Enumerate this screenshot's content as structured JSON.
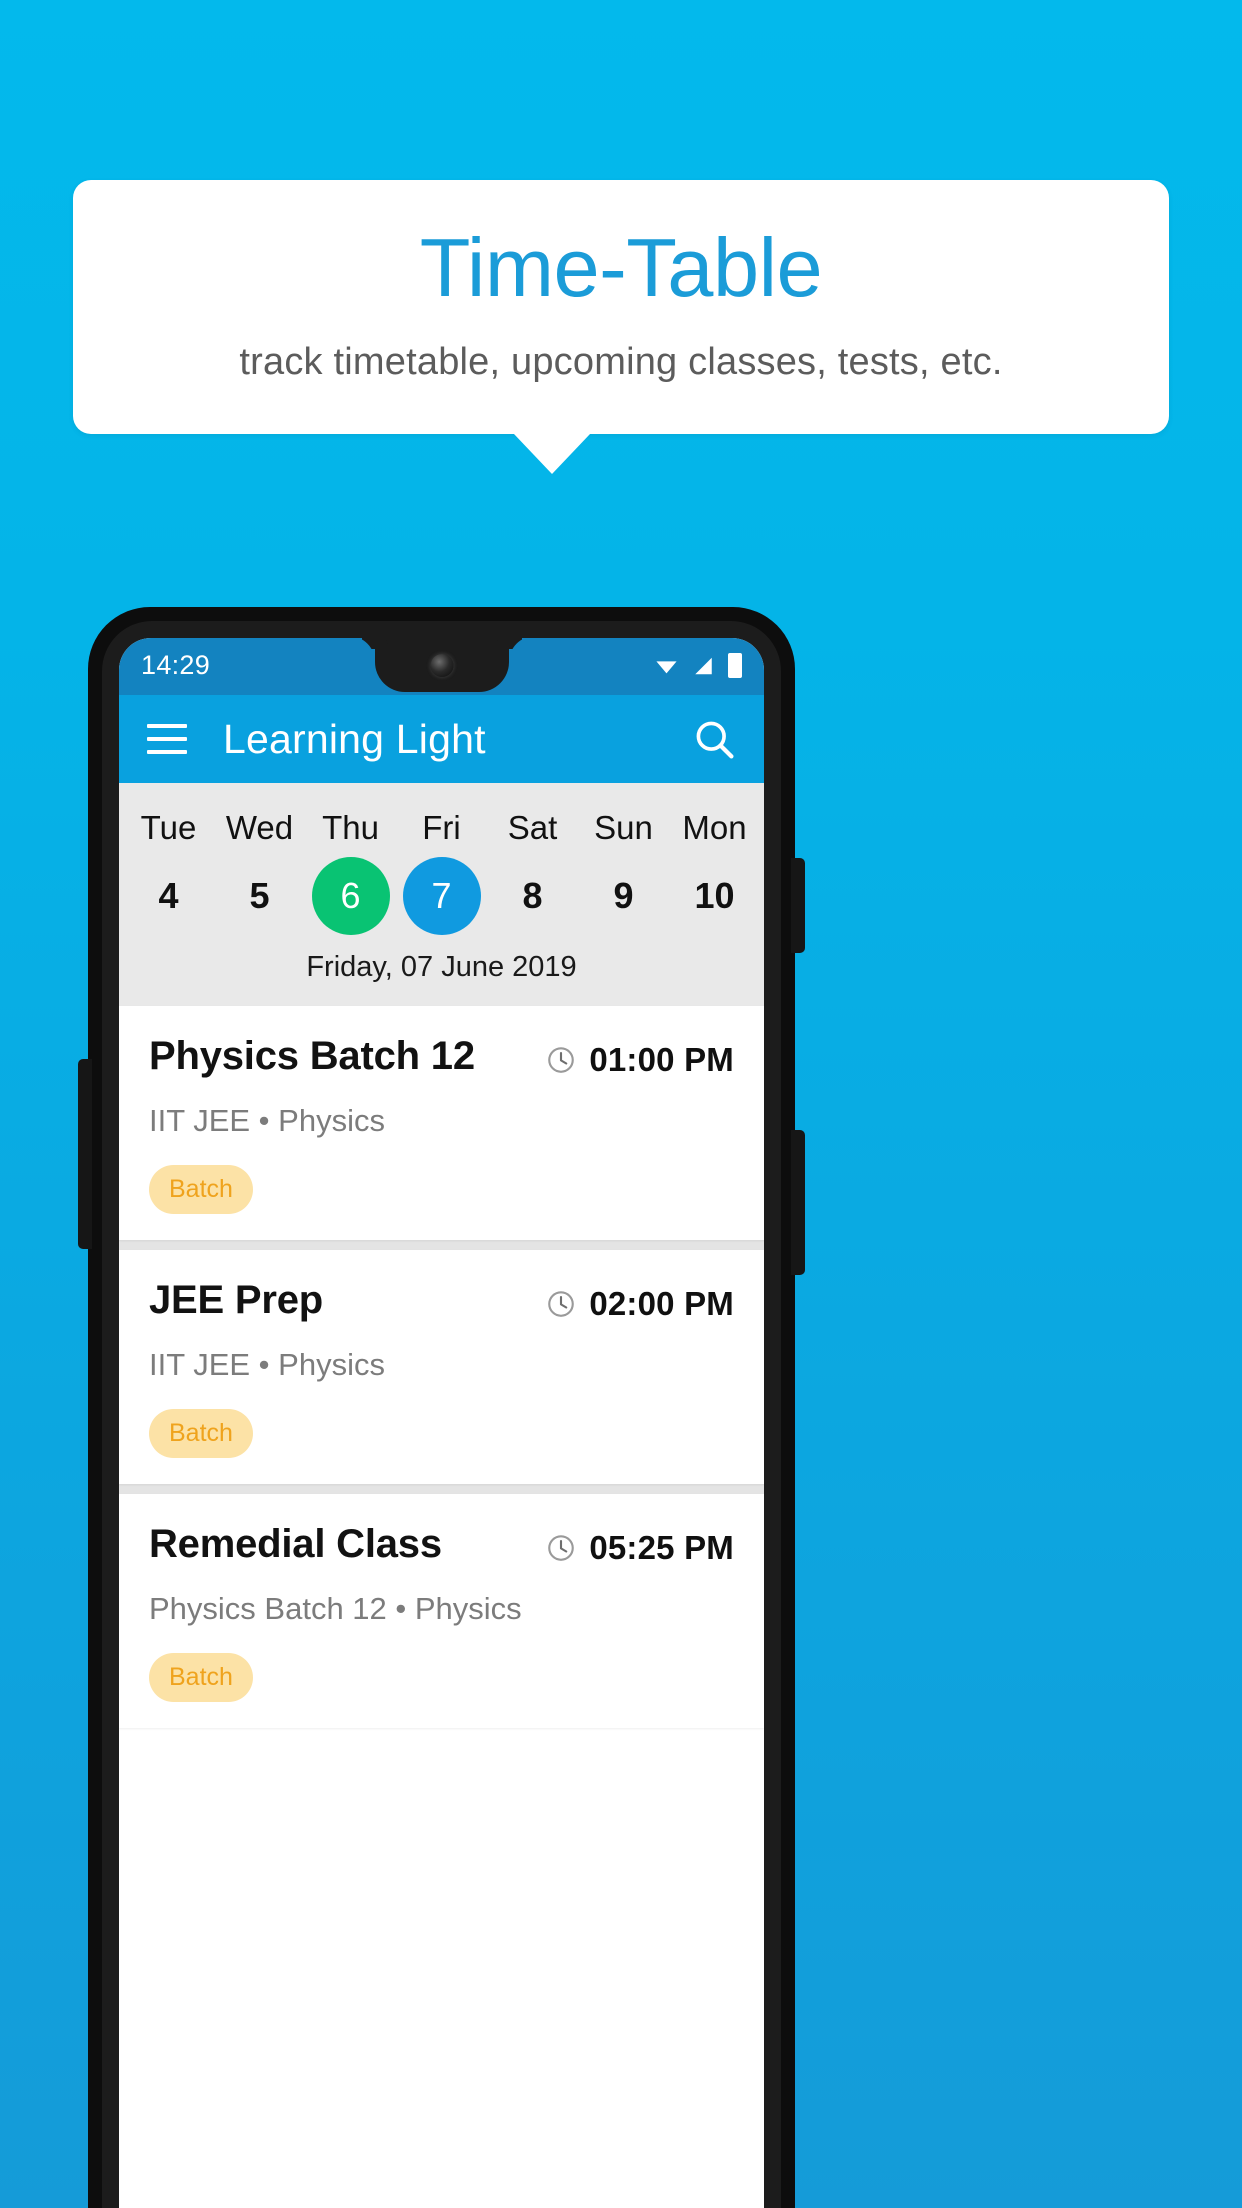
{
  "banner": {
    "title": "Time-Table",
    "subtitle": "track timetable, upcoming classes, tests, etc.",
    "title_color": "#1B9CD8"
  },
  "background": {
    "color_top": "#03B9EC",
    "color_bottom": "#159BD8"
  },
  "phone": {
    "statusbar": {
      "time": "14:29",
      "background": "#1383C0",
      "icons": [
        "wifi-icon",
        "signal-icon",
        "battery-icon"
      ]
    },
    "appbar": {
      "menu_icon": "hamburger-menu-icon",
      "title": "Learning Light",
      "search_icon": "search-icon",
      "background": "#09A1DF"
    },
    "daystrip": {
      "background": "#E9E9E9",
      "days": [
        {
          "name": "Tue",
          "num": "4",
          "state": "normal"
        },
        {
          "name": "Wed",
          "num": "5",
          "state": "normal"
        },
        {
          "name": "Thu",
          "num": "6",
          "state": "today"
        },
        {
          "name": "Fri",
          "num": "7",
          "state": "selected"
        },
        {
          "name": "Sat",
          "num": "8",
          "state": "normal"
        },
        {
          "name": "Sun",
          "num": "9",
          "state": "normal"
        },
        {
          "name": "Mon",
          "num": "10",
          "state": "normal"
        }
      ],
      "today_color": "#09C373",
      "selected_color": "#109AE0",
      "date_label": "Friday, 07 June 2019"
    },
    "classes": [
      {
        "title": "Physics Batch 12",
        "subtitle": "IIT JEE • Physics",
        "time": "01:00 PM",
        "badge": "Batch"
      },
      {
        "title": "JEE Prep",
        "subtitle": "IIT JEE • Physics",
        "time": "02:00 PM",
        "badge": "Batch"
      },
      {
        "title": "Remedial Class",
        "subtitle": "Physics Batch 12 • Physics",
        "time": "05:25 PM",
        "badge": "Batch"
      }
    ],
    "badge_colors": {
      "background": "#FCE2A6",
      "text": "#EFA31D"
    }
  }
}
